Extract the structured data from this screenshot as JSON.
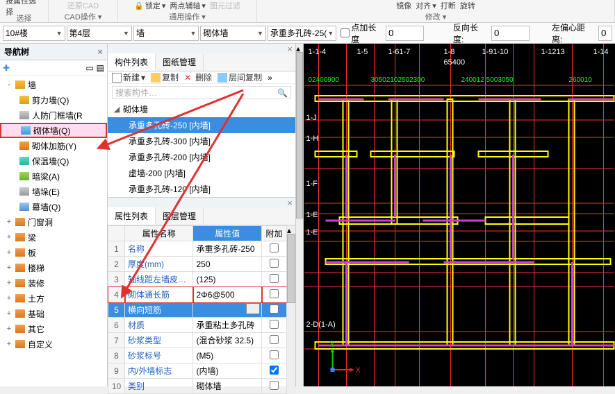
{
  "ribbon": {
    "group1_label": "选择",
    "group1_btn1": "按属性选择",
    "group2_label": "CAD操作",
    "group2_btn1": "还原CAD",
    "group3_label": "通用操作",
    "group3_btn1": "锁定",
    "group3_btn2": "两点辅轴",
    "group3_btn3": "图元过滤",
    "group4_label": "修改",
    "group4_btn1": "镜像",
    "group4_btn2": "对齐",
    "group4_btn3": "打断",
    "group4_btn4": "旋转"
  },
  "dropdowns": {
    "building": "10#楼",
    "floor": "第4层",
    "category": "墙",
    "subtype": "砌体墙",
    "spec": "承重多孔砖-25(",
    "point_add_label": "点加长度",
    "point_add_val": "0",
    "reverse_label": "反向长度:",
    "reverse_val": "0",
    "left_offset_label": "左偏心距离:",
    "left_offset_val": "0"
  },
  "nav": {
    "title": "导航树",
    "items": [
      {
        "label": "墙",
        "icon": "wall",
        "expand": "-"
      },
      {
        "label": "剪力墙(Q)",
        "icon": "wall",
        "l2": true
      },
      {
        "label": "人防门框墙(R",
        "icon": "gray",
        "l2": true
      },
      {
        "label": "砌体墙(Q)",
        "icon": "brick",
        "l2": true,
        "highlight": true
      },
      {
        "label": "砌体加筋(Y)",
        "icon": "orange",
        "l2": true
      },
      {
        "label": "保温墙(Q)",
        "icon": "cyan",
        "l2": true
      },
      {
        "label": "暗梁(A)",
        "icon": "green",
        "l2": true
      },
      {
        "label": "墙垛(E)",
        "icon": "gray",
        "l2": true
      },
      {
        "label": "幕墙(Q)",
        "icon": "blue",
        "l2": true
      },
      {
        "label": "门窗洞",
        "icon": "orange",
        "expand": "+"
      },
      {
        "label": "梁",
        "icon": "orange",
        "expand": "+"
      },
      {
        "label": "板",
        "icon": "orange",
        "expand": "+"
      },
      {
        "label": "楼梯",
        "icon": "orange",
        "expand": "+"
      },
      {
        "label": "装修",
        "icon": "orange",
        "expand": "+"
      },
      {
        "label": "土方",
        "icon": "orange",
        "expand": "+"
      },
      {
        "label": "基础",
        "icon": "orange",
        "expand": "+"
      },
      {
        "label": "其它",
        "icon": "orange",
        "expand": "+"
      },
      {
        "label": "自定义",
        "icon": "orange",
        "expand": "+"
      }
    ]
  },
  "complist": {
    "tab1": "构件列表",
    "tab2": "图纸管理",
    "new_btn": "新建",
    "copy_btn": "复制",
    "del_btn": "删除",
    "layer_copy_btn": "层间复制",
    "search_placeholder": "搜索构件…",
    "group": "砌体墙",
    "items": [
      "承重多孔砖-250 [内墙]",
      "承重多孔砖-300 [内墙]",
      "承重多孔砖-200 [内墙]",
      "虚墙-200 [内墙]",
      "承重多孔砖-120 [内墙]"
    ]
  },
  "proplist": {
    "tab1": "属性列表",
    "tab2": "图层管理",
    "col_name": "属性名称",
    "col_value": "属性值",
    "col_extra": "附加",
    "rows": [
      {
        "n": "1",
        "name": "名称",
        "value": "承重多孔砖-250"
      },
      {
        "n": "2",
        "name": "厚度(mm)",
        "value": "250"
      },
      {
        "n": "3",
        "name": "轴线距左墙皮…",
        "value": "(125)"
      },
      {
        "n": "4",
        "name": "砌体通长筋",
        "value": "2Φ6@500",
        "hl": true
      },
      {
        "n": "5",
        "name": "横向短筋",
        "value": "",
        "sel": true,
        "browse": true
      },
      {
        "n": "6",
        "name": "材质",
        "value": "承重粘土多孔砖"
      },
      {
        "n": "7",
        "name": "砂浆类型",
        "value": "(混合砂浆  32.5)"
      },
      {
        "n": "8",
        "name": "砂浆标号",
        "value": "(M5)"
      },
      {
        "n": "9",
        "name": "内/外墙标志",
        "value": "(内墙)",
        "checked": true
      },
      {
        "n": "10",
        "name": "类别",
        "value": "砌体墙"
      }
    ]
  },
  "cad": {
    "top_dim": "65400",
    "grids_top": [
      "1-1-4",
      "1-5",
      "1-61-7",
      "1-8",
      "1-91-10",
      "1-1213",
      "1-14"
    ],
    "dims": [
      "02400900",
      "30502102502300",
      "240012 5003050",
      "260010"
    ],
    "grids_left": [
      "1-J",
      "1-H",
      "1-F",
      "1-E",
      "1-E"
    ],
    "grid_bottom": "2-D(1-A)",
    "axis_y": "Y",
    "axis_x": "X"
  }
}
